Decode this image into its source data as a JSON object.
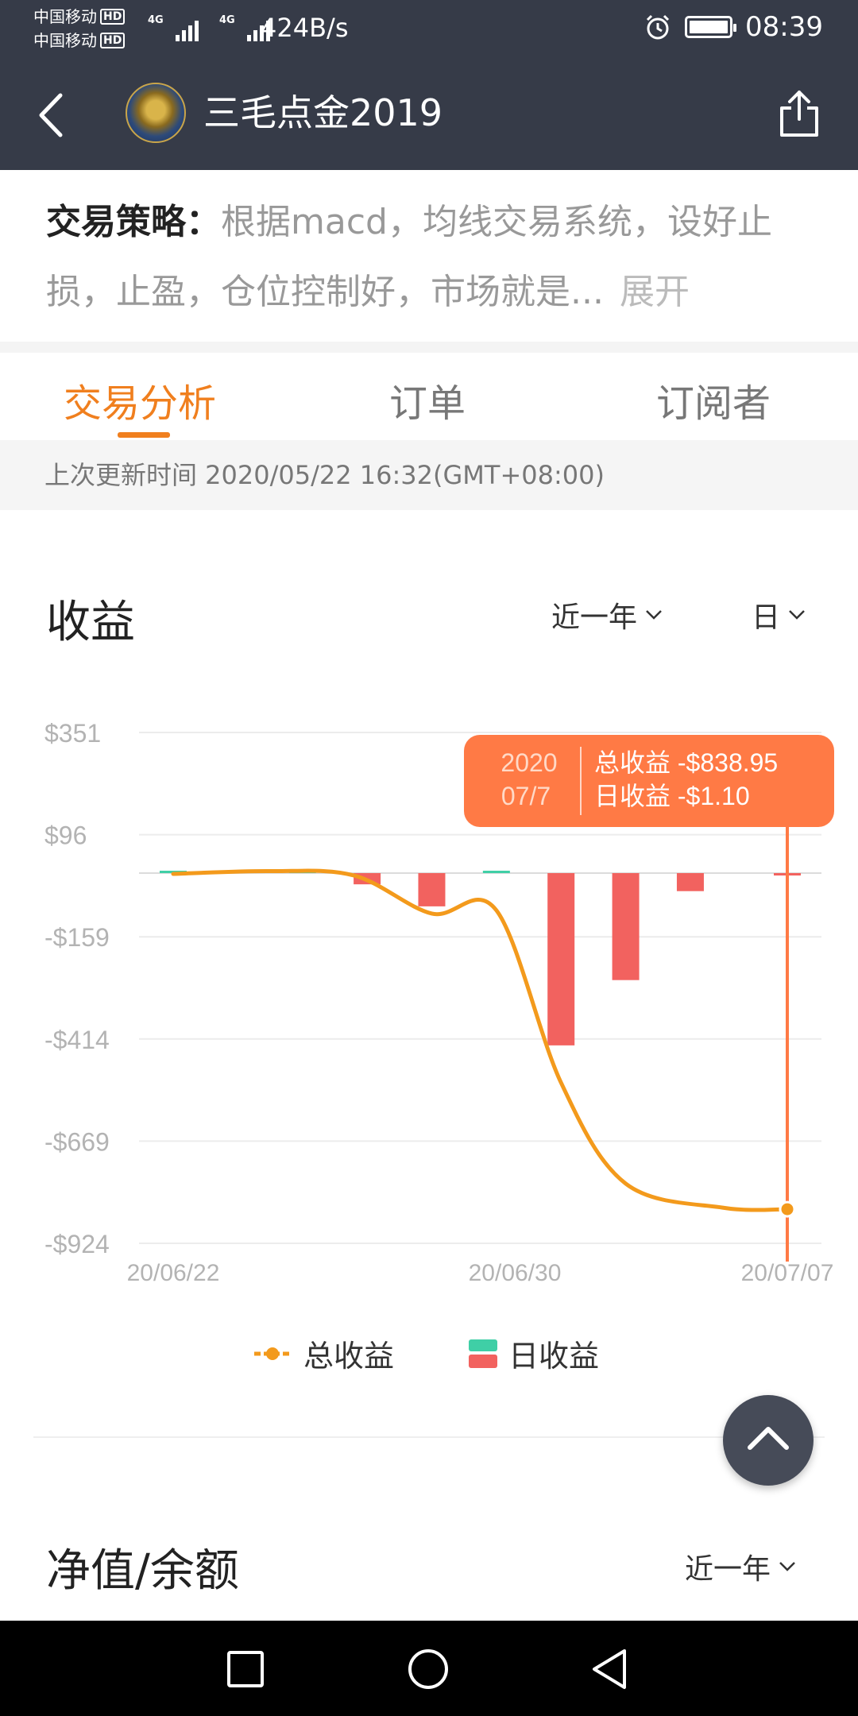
{
  "status_bar": {
    "carrier_1": "中国移动",
    "carrier_2": "中国移动",
    "hd_badge": "HD",
    "network_1": "4G",
    "network_2": "4G",
    "net_speed": "424B/s",
    "time": "08:39",
    "battery_level": 1.0
  },
  "header": {
    "title": "三毛点金2019"
  },
  "strategy": {
    "label": "交易策略：",
    "text": "根据macd，均线交易系统，设好止损，止盈，仓位控制好，市场就是...",
    "expand": "展开"
  },
  "tabs": [
    {
      "label": "交易分析",
      "active": true
    },
    {
      "label": "订单",
      "active": false
    },
    {
      "label": "订阅者",
      "active": false
    }
  ],
  "last_updated": "上次更新时间 2020/05/22 16:32(GMT+08:00)",
  "profit_section": {
    "title": "收益",
    "range_dropdown": "近一年",
    "period_dropdown": "日"
  },
  "tooltip": {
    "year": "2020",
    "date": "07/7",
    "total_line": "总收益 -$838.95",
    "daily_line": "日收益 -$1.10"
  },
  "chart_data": {
    "type": "bar",
    "y_ticks": [
      "$351",
      "$96",
      "-$159",
      "-$414",
      "-$669",
      "-$924"
    ],
    "ylim": [
      -924,
      351
    ],
    "x_ticks": [
      "20/06/22",
      "20/06/30",
      "20/07/07"
    ],
    "series": [
      {
        "name": "总收益",
        "kind": "line",
        "color": "#f39a1c",
        "points": [
          [
            0,
            -2
          ],
          [
            1.5,
            5
          ],
          [
            2.8,
            -6
          ],
          [
            4,
            -101
          ],
          [
            5,
            -93
          ],
          [
            6,
            -523
          ],
          [
            7,
            -775
          ],
          [
            8.5,
            -835
          ],
          [
            9.5,
            -838.95
          ]
        ]
      },
      {
        "name": "日收益",
        "kind": "bar",
        "color_positive": "#3fcfa6",
        "color_negative": "#f2625f",
        "bars": [
          [
            0,
            1
          ],
          [
            2,
            4
          ],
          [
            3,
            -28
          ],
          [
            4,
            -83
          ],
          [
            5,
            4
          ],
          [
            6,
            -430
          ],
          [
            7,
            -267
          ],
          [
            8,
            -45
          ],
          [
            9.5,
            -1.1
          ]
        ]
      }
    ],
    "x_domain": [
      0,
      9.5
    ],
    "highlight_index": 9.5,
    "grid": true,
    "legend_position": "bottom"
  },
  "legend": {
    "total": "总收益",
    "daily": "日收益"
  },
  "nav_section": {
    "title": "净值/余额",
    "range_dropdown": "近一年"
  },
  "colors": {
    "header_bg": "#363b48",
    "accent": "#f07f1e",
    "tooltip_bg": "#ff7a45"
  }
}
